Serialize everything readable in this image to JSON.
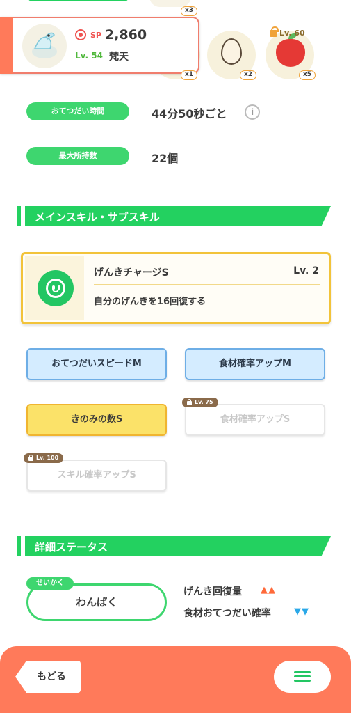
{
  "top": {
    "chip_top_item": "x3",
    "chip_card_item": "x1",
    "chip_egg": "x2",
    "chip_apple": "x5",
    "apple_lock_level": "Lv. 60"
  },
  "pokemon": {
    "sp_label": "SP",
    "sp_value": "2,860",
    "level": "Lv. 54",
    "name": "梵天"
  },
  "info": {
    "help_time_label": "おてつだい時間",
    "help_time_value": "44分50秒ごと",
    "info_icon_glyph": "i",
    "max_carry_label": "最大所持数",
    "max_carry_value": "22個"
  },
  "skills": {
    "section_title": "メインスキル・サブスキル",
    "main": {
      "name": "げんきチャージS",
      "level": "Lv. 2",
      "description": "自分のげんきを16回復する",
      "icon": "smile-icon"
    },
    "sub": [
      {
        "label": "おてつだいスピードM",
        "state": "unlocked",
        "color": "blue"
      },
      {
        "label": "食材確率アップM",
        "state": "unlocked",
        "color": "blue"
      },
      {
        "label": "きのみの数S",
        "state": "unlocked",
        "color": "yellow"
      },
      {
        "label": "食材確率アップS",
        "state": "locked",
        "lock_level": "Lv. 75"
      },
      {
        "label": "スキル確率アップS",
        "state": "locked",
        "lock_level": "Lv. 100"
      }
    ]
  },
  "status": {
    "section_title": "詳細ステータス",
    "nature_tag": "せいかく",
    "nature_value": "わんぱく",
    "up_effect": "げんき回復量",
    "up_arrows": "▲▲",
    "down_effect": "食材おてつだい確率",
    "down_arrows": "▼▼"
  },
  "footer": {
    "back_label": "もどる",
    "menu_icon": "hamburger-menu-icon"
  },
  "colors": {
    "accent_green": "#23d160",
    "footer_coral": "#ff7a5a",
    "up_arrow": "#ff6a3a",
    "down_arrow": "#2aa8e8"
  }
}
